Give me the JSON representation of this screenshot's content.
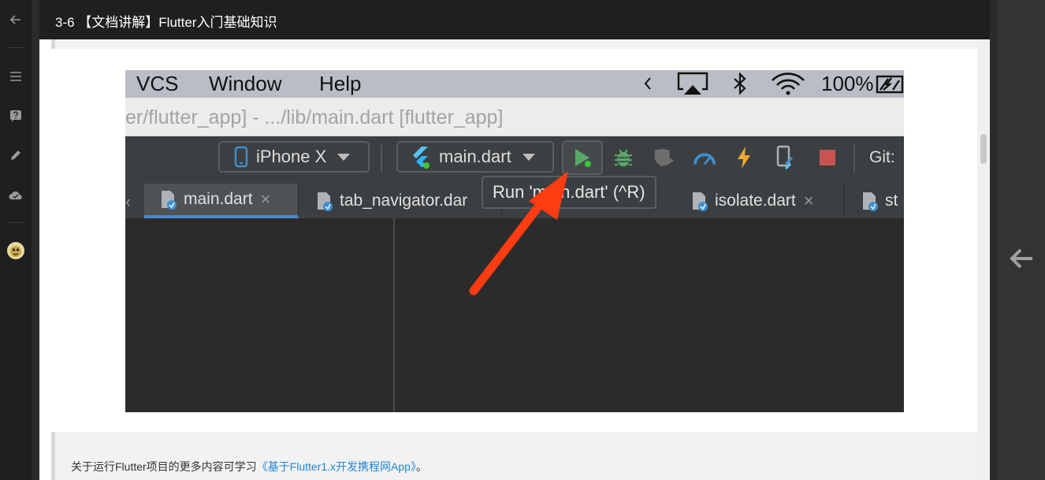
{
  "page": {
    "title": "3-6 【文档讲解】Flutter入门基础知识"
  },
  "rail": {
    "icons": [
      "back-arrow-icon",
      "list-icon",
      "question-icon",
      "pencil-icon",
      "cloud-icon",
      "avatar"
    ]
  },
  "screenshot": {
    "menubar": {
      "items": [
        "VCS",
        "Window",
        "Help"
      ],
      "status": {
        "battery": "100%"
      }
    },
    "path": "er/flutter_app] - .../lib/main.dart [flutter_app]",
    "toolbar": {
      "device": "iPhone X",
      "run_config": "main.dart",
      "git_label": "Git:"
    },
    "tabs": [
      {
        "label": "main.dart",
        "close": "×"
      },
      {
        "label": "tab_navigator.dar"
      },
      {
        "label": "isolate.dart",
        "close": "×"
      },
      {
        "label": "st"
      }
    ],
    "tooltip": "Run 'main.dart' (^R)"
  },
  "note": {
    "text": "关于运行Flutter项目的更多内容可学习",
    "link": "《基于Flutter1.x开发携程网App》",
    "suffix": "。"
  },
  "colors": {
    "accent_link": "#1e87d6",
    "run_green": "#59a869",
    "stop_red": "#c75450",
    "arrow_red": "#ff3b12"
  }
}
